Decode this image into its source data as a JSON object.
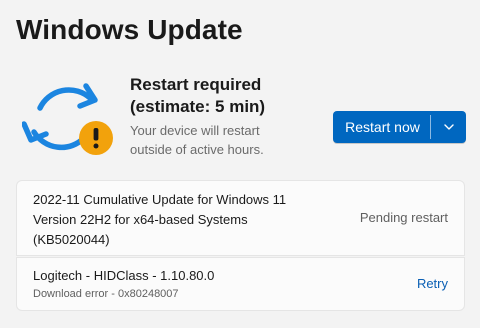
{
  "page": {
    "title": "Windows Update"
  },
  "status": {
    "heading_line1": "Restart required",
    "heading_line2": "(estimate: 5 min)",
    "sub_line1": "Your device will restart",
    "sub_line2": "outside of active hours.",
    "icon": "sync-arrows-icon",
    "badge_icon": "warning-icon"
  },
  "actions": {
    "restart_label": "Restart now",
    "dropdown_icon": "chevron-down-icon"
  },
  "updates": [
    {
      "name_line1": "2022-11 Cumulative Update for Windows 11",
      "name_line2": "Version 22H2 for x64-based Systems",
      "name_line3": "(KB5020044)",
      "state": "Pending restart"
    },
    {
      "name": "Logitech - HIDClass - 1.10.80.0",
      "error": "Download error - 0x80248007",
      "action": "Retry"
    }
  ],
  "colors": {
    "accent": "#0067c0",
    "sync_icon": "#1b85e0",
    "warning_badge": "#f2a20c",
    "background": "#f3f3f3"
  }
}
